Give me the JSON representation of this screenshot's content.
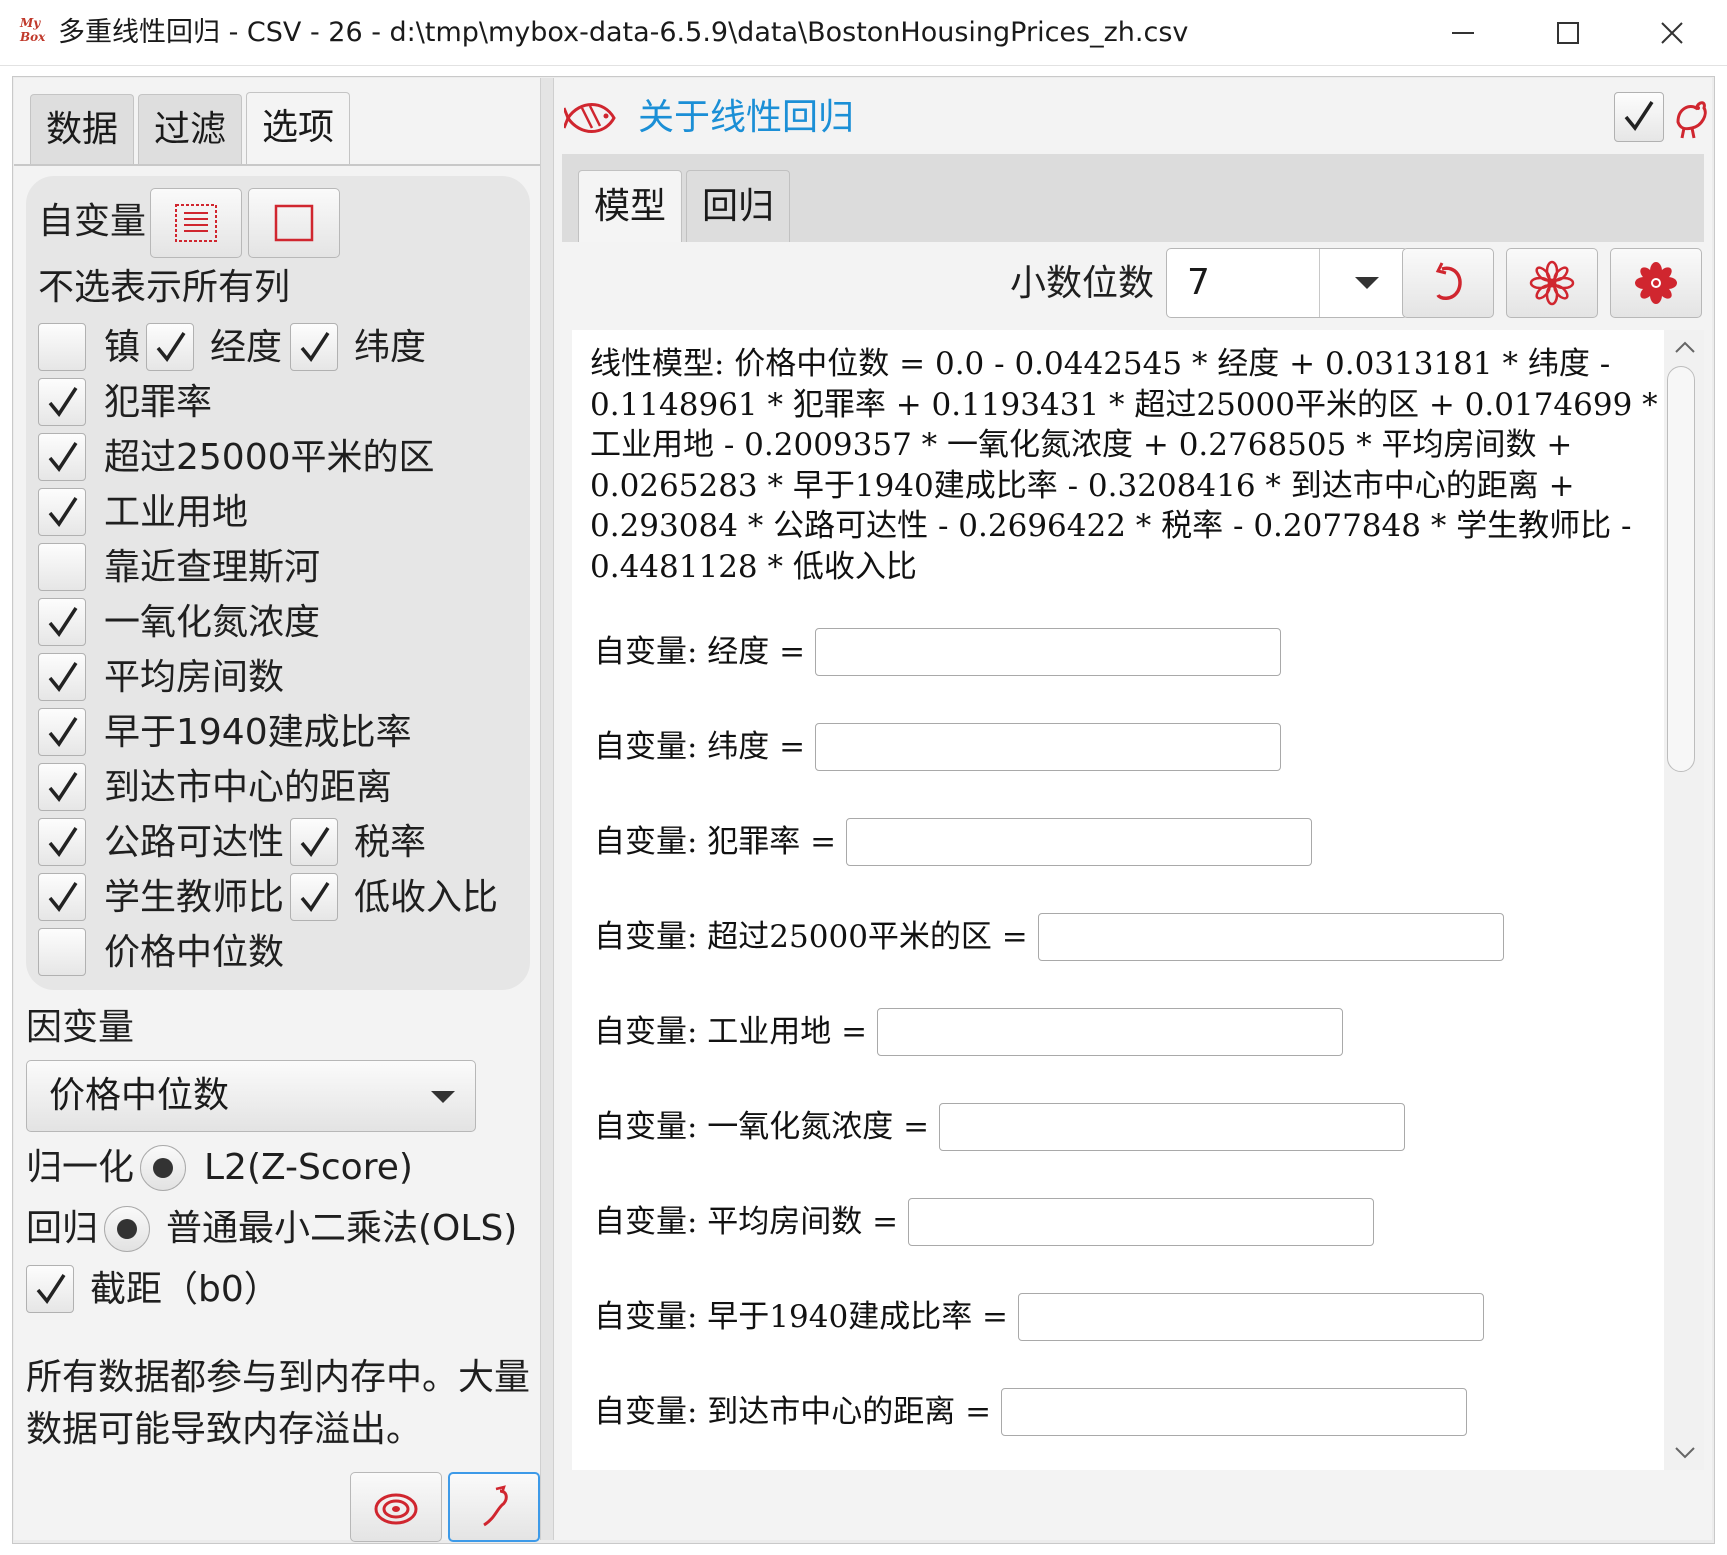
{
  "window": {
    "title": "多重线性回归 - CSV - 26 - d:\\tmp\\mybox-data-6.5.9\\data\\BostonHousingPrices_zh.csv",
    "logo_text": "My Box",
    "minimize_icon": "minimize-icon",
    "maximize_icon": "maximize-icon",
    "close_icon": "close-icon"
  },
  "left": {
    "tabs": [
      "数据",
      "过滤",
      "选项"
    ],
    "selected_tab": "选项",
    "independent_label": "自变量",
    "select_all_icon": "select-all-icon",
    "select_none_icon": "select-none-icon",
    "hint": "不选表示所有列",
    "columns": [
      {
        "label": "镇",
        "checked": false
      },
      {
        "label": "经度",
        "checked": true
      },
      {
        "label": "纬度",
        "checked": true
      },
      {
        "label": "犯罪率",
        "checked": true
      },
      {
        "label": "超过25000平米的区",
        "checked": true
      },
      {
        "label": "工业用地",
        "checked": true
      },
      {
        "label": "靠近查理斯河",
        "checked": false
      },
      {
        "label": "一氧化氮浓度",
        "checked": true
      },
      {
        "label": "平均房间数",
        "checked": true
      },
      {
        "label": "早于1940建成比率",
        "checked": true
      },
      {
        "label": "到达市中心的距离",
        "checked": true
      },
      {
        "label": "公路可达性",
        "checked": true
      },
      {
        "label": "税率",
        "checked": true
      },
      {
        "label": "学生教师比",
        "checked": true
      },
      {
        "label": "低收入比",
        "checked": true
      },
      {
        "label": "价格中位数",
        "checked": false
      }
    ],
    "dependent_label": "因变量",
    "dependent_value": "价格中位数",
    "normalize_label": "归一化",
    "normalize_option": "L2(Z-Score)",
    "regression_label": "回归",
    "regression_option": "普通最小二乘法(OLS)",
    "intercept_label": "截距（b0）",
    "intercept_checked": true,
    "memory_note": "所有数据都参与到内存中。大量数据可能导致内存溢出。",
    "clear_icon": "clear-icon",
    "start_icon": "start-icon"
  },
  "right": {
    "about_icon": "fish-icon",
    "about_title": "关于线性回归",
    "corner_check": true,
    "corner_icon": "rooster-icon",
    "subtabs": [
      "模型",
      "回归"
    ],
    "selected_subtab": "模型",
    "scale_label": "小数位数",
    "scale_value": "7",
    "refresh_icon": "refresh-icon",
    "flower_icon_1": "flower-outline-icon",
    "flower_icon_2": "flower-filled-icon",
    "model_text": "线性模型: 价格中位数 = 0.0 - 0.0442545 * 经度 + 0.0313181 * 纬度 - 0.1148961 * 犯罪率 + 0.1193431 * 超过25000平米的区 + 0.0174699 * 工业用地 - 0.2009357 * 一氧化氮浓度 + 0.2768505 * 平均房间数 + 0.0265283 * 早于1940建成比率 - 0.3208416 * 到达市中心的距离 + 0.293084 * 公路可达性 - 0.2696422 * 税率 - 0.2077848 * 学生教师比 - 0.4481128 * 低收入比",
    "inputs": [
      {
        "label": "自变量: 经度 =",
        "value": ""
      },
      {
        "label": "自变量: 纬度 =",
        "value": ""
      },
      {
        "label": "自变量: 犯罪率 =",
        "value": ""
      },
      {
        "label": "自变量: 超过25000平米的区 =",
        "value": ""
      },
      {
        "label": "自变量: 工业用地 =",
        "value": ""
      },
      {
        "label": "自变量: 一氧化氮浓度 =",
        "value": ""
      },
      {
        "label": "自变量: 平均房间数 =",
        "value": ""
      },
      {
        "label": "自变量: 早于1940建成比率 =",
        "value": ""
      },
      {
        "label": "自变量: 到达市中心的距离 =",
        "value": ""
      }
    ]
  },
  "colors": {
    "accent": "#1b8fd6",
    "icon_red": "#d0262f",
    "focus_blue": "#3d9ae8"
  }
}
